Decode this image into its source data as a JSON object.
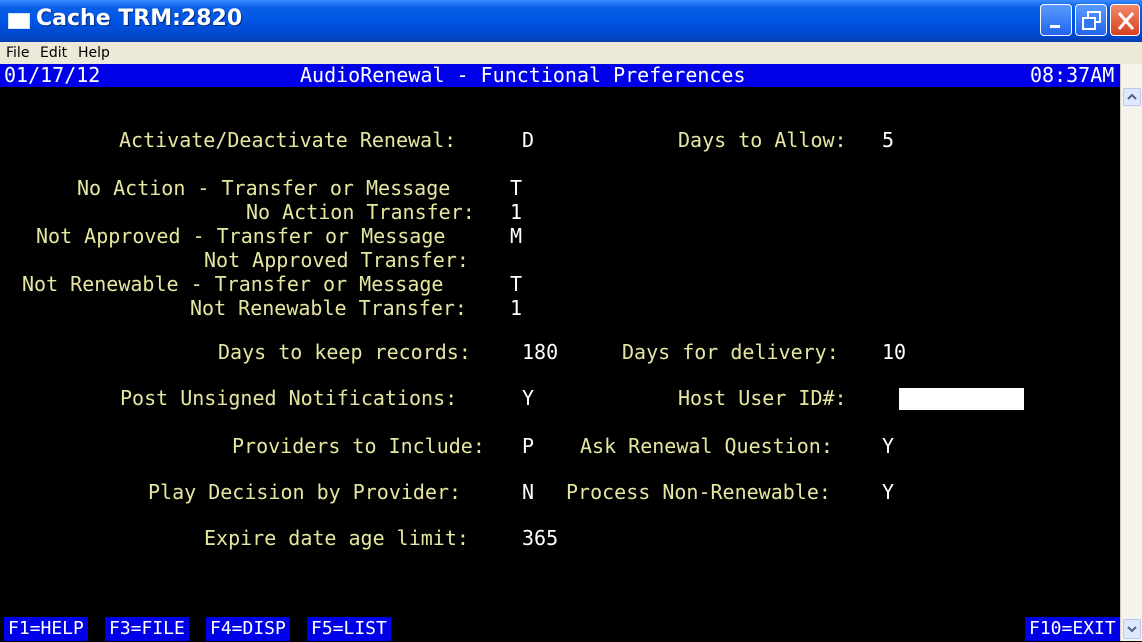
{
  "window": {
    "title": "Cache TRM:2820"
  },
  "menu": {
    "items": [
      "File",
      "Edit",
      "Help"
    ]
  },
  "header": {
    "date": "01/17/12",
    "title": "AudioRenewal - Functional Preferences",
    "time": "08:37AM"
  },
  "fields": {
    "activate_label": "Activate/Deactivate Renewal:",
    "activate_value": "D",
    "days_allow_label": "Days to Allow:",
    "days_allow_value": "5",
    "no_action_label": "No Action - Transfer or Message",
    "no_action_value": "T",
    "no_action_transfer_label": "No Action Transfer:",
    "no_action_transfer_value": "1",
    "not_approved_label": "Not Approved - Transfer or Message",
    "not_approved_value": "M",
    "not_approved_transfer_label": "Not Approved Transfer:",
    "not_approved_transfer_value": "",
    "not_renewable_label": "Not Renewable - Transfer or Message",
    "not_renewable_value": "T",
    "not_renewable_transfer_label": "Not Renewable Transfer:",
    "not_renewable_transfer_value": "1",
    "keep_records_label": "Days to keep records:",
    "keep_records_value": "180",
    "delivery_label": "Days for delivery:",
    "delivery_value": "10",
    "post_unsigned_label": "Post Unsigned Notifications:",
    "post_unsigned_value": "Y",
    "host_user_label": "Host User ID#:",
    "host_user_value": "",
    "providers_label": "Providers to Include:",
    "providers_value": "P",
    "ask_renewal_label": "Ask Renewal Question:",
    "ask_renewal_value": "Y",
    "play_decision_label": "Play Decision by Provider:",
    "play_decision_value": "N",
    "process_nonrenew_label": "Process Non-Renewable:",
    "process_nonrenew_value": "Y",
    "expire_label": "Expire date age limit:",
    "expire_value": "365"
  },
  "function_keys": {
    "f1": "F1=HELP",
    "f3": "F3=FILE",
    "f4": "F4=DISP",
    "f5": "F5=LIST",
    "f10": "F10=EXIT"
  },
  "colors": {
    "terminal_bg": "#000000",
    "header_bg": "#0000e8",
    "label": "#e6e6a0",
    "value": "#ffffff",
    "titlebar": "#0054e3"
  },
  "icons": {
    "app": "terminal-window-icon",
    "minimize": "minimize-icon",
    "maximize": "restore-icon",
    "close": "close-icon"
  }
}
